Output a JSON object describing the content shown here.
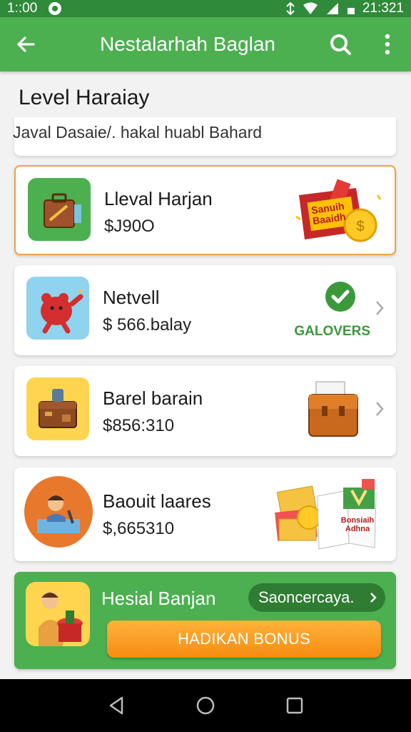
{
  "status_bar": {
    "time": "1::00",
    "clock": "21:321"
  },
  "app_bar": {
    "title": "Nestalarhah Baglan"
  },
  "section": {
    "title": "Level Haraiay"
  },
  "search": {
    "text": "Javal Dasaie/. hakal huabl Bahard"
  },
  "cards": [
    {
      "name": "Lleval Harjan",
      "price": "$J90O",
      "thumb_icon": "suitcase-icon",
      "art_icon": "cash-envelope-icon",
      "art_text": "Sanuih Baaidh"
    },
    {
      "name": "Netvell",
      "price": "$ 566.balay",
      "thumb_icon": "red-bear-icon",
      "status": "GALOVERS",
      "status_icon": "check-circle-icon"
    },
    {
      "name": "Barel barain",
      "price": "$856:310",
      "thumb_icon": "wooden-chest-icon",
      "art_icon": "briefcase-icon"
    },
    {
      "name": "Baouit laares",
      "price": "$,665310",
      "thumb_icon": "person-at-desk-icon",
      "art_icon": "money-book-icon",
      "art_text": "Bonsiaih Adhna"
    }
  ],
  "bonus": {
    "name": "Hesial Banjan",
    "pill_label": "Saoncercaya.",
    "cta": "HADIKAN BONUS",
    "thumb_icon": "person-with-basket-icon"
  },
  "colors": {
    "primary": "#4caf50",
    "primary_dark": "#2f8a3a",
    "accent": "#f58c12",
    "highlight_border": "#f0a04a"
  }
}
